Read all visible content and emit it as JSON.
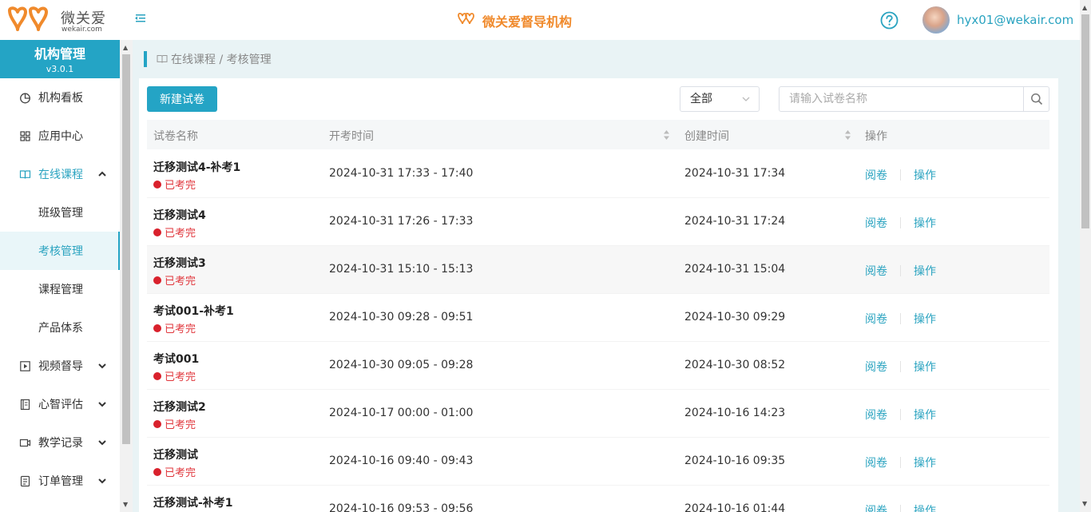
{
  "header": {
    "logo_text": "微关爱",
    "logo_sub": "wekair.com",
    "brand_name": "微关爱督导机构",
    "user_email": "hyx01@wekair.com"
  },
  "sidebar": {
    "title": "机构管理",
    "version": "v3.0.1",
    "items": [
      {
        "label": "机构看板",
        "icon": "dashboard-icon"
      },
      {
        "label": "应用中心",
        "icon": "grid-icon"
      },
      {
        "label": "在线课程",
        "icon": "book-icon",
        "expanded": true
      },
      {
        "label": "班级管理"
      },
      {
        "label": "考核管理",
        "active": true
      },
      {
        "label": "课程管理"
      },
      {
        "label": "产品体系"
      },
      {
        "label": "视频督导",
        "icon": "video-icon"
      },
      {
        "label": "心智评估",
        "icon": "notebook-icon"
      },
      {
        "label": "教学记录",
        "icon": "camera-icon"
      },
      {
        "label": "订单管理",
        "icon": "order-icon"
      }
    ]
  },
  "breadcrumb": "在线课程 / 考核管理",
  "toolbar": {
    "new_button": "新建试卷",
    "filter_value": "全部",
    "search_placeholder": "请输入试卷名称"
  },
  "table": {
    "columns": [
      "试卷名称",
      "开考时间",
      "创建时间",
      "操作"
    ],
    "rows": [
      {
        "name": "迁移测试4-补考1",
        "status": "已考完",
        "time": "2024-10-31 17:33 - 17:40",
        "created": "2024-10-31 17:34"
      },
      {
        "name": "迁移测试4",
        "status": "已考完",
        "time": "2024-10-31 17:26 - 17:33",
        "created": "2024-10-31 17:24"
      },
      {
        "name": "迁移测试3",
        "status": "已考完",
        "time": "2024-10-31 15:10 - 15:13",
        "created": "2024-10-31 15:04"
      },
      {
        "name": "考试001-补考1",
        "status": "已考完",
        "time": "2024-10-30 09:28 - 09:51",
        "created": "2024-10-30 09:29"
      },
      {
        "name": "考试001",
        "status": "已考完",
        "time": "2024-10-30 09:05 - 09:28",
        "created": "2024-10-30 08:52"
      },
      {
        "name": "迁移测试2",
        "status": "已考完",
        "time": "2024-10-17 00:00 - 01:00",
        "created": "2024-10-16 14:23"
      },
      {
        "name": "迁移测试",
        "status": "已考完",
        "time": "2024-10-16 09:40 - 09:43",
        "created": "2024-10-16 09:35"
      },
      {
        "name": "迁移测试-补考1",
        "status": "",
        "time": "2024-10-16 09:53 - 09:56",
        "created": "2024-10-16 01:44"
      }
    ],
    "action_review": "阅卷",
    "action_operate": "操作"
  },
  "colors": {
    "accent": "#24a4c5",
    "link": "#2aa3c0",
    "brand": "#f08a2c",
    "status_done": "#d9212c"
  }
}
